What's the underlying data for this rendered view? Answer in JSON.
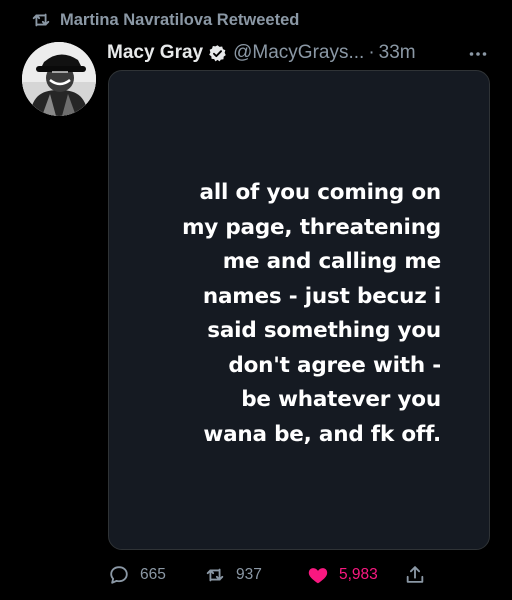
{
  "retweet_header": {
    "label": "Martina Navratilova Retweeted",
    "icon": "retweet-icon"
  },
  "tweet": {
    "author": {
      "display_name": "Macy Gray",
      "handle": "@MacyGrays...",
      "verified": true,
      "avatar": "avatar-photo"
    },
    "separator": "·",
    "time": "33m",
    "more_icon": "more-icon",
    "media_text_lines": [
      "all of you coming on",
      "my page, threatening",
      "me and calling me",
      "names - just becuz i",
      "said something you",
      "don't agree with -",
      "be whatever you",
      "wana be, and fk off."
    ]
  },
  "actions": {
    "reply_count": "665",
    "retweet_count": "937",
    "like_count": "5,983",
    "liked": true,
    "share_icon": "share-icon"
  },
  "colors": {
    "background": "#000000",
    "secondary_text": "#8b98a5",
    "media_background": "#151a22",
    "like_pink": "#f91880",
    "verified_bg": "#e7e9ea"
  }
}
